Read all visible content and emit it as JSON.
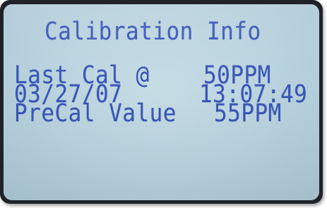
{
  "display": {
    "title": "Calibration Info",
    "rows": [
      {
        "label": "Last Cal @",
        "value": "50PPM"
      },
      {
        "label": "03/27/07",
        "value": "13:07:49"
      },
      {
        "label": "PreCal Value",
        "value": "55PPM"
      }
    ]
  },
  "colors": {
    "lcd_background": "#b8d2dd",
    "lcd_text": "#3a56b8",
    "bezel": "#1f2328"
  }
}
